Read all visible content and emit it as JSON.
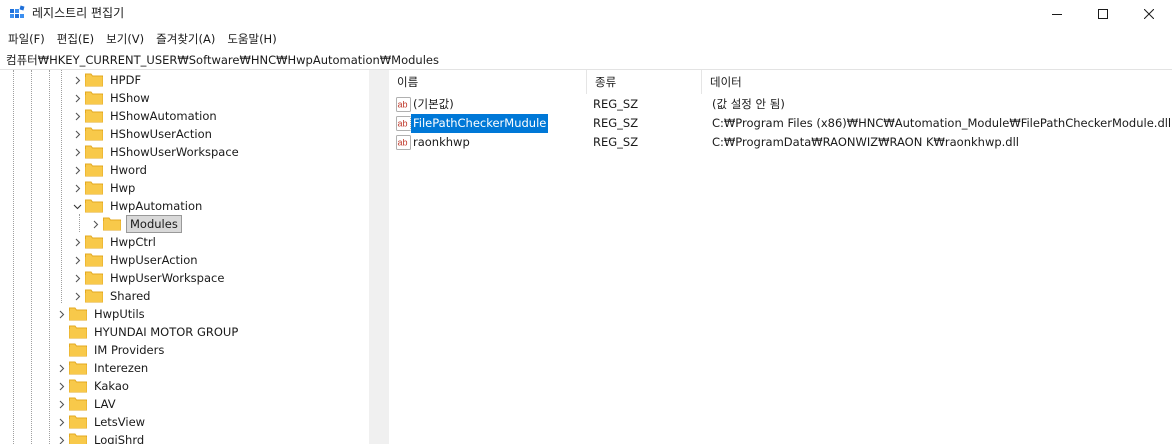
{
  "window": {
    "title": "레지스트리 편집기"
  },
  "menu": {
    "items": [
      "파일(F)",
      "편집(E)",
      "보기(V)",
      "즐겨찾기(A)",
      "도움말(H)"
    ]
  },
  "address": {
    "path": "컴퓨터₩HKEY_CURRENT_USER₩Software₩HNC₩HwpAutomation₩Modules"
  },
  "tree": {
    "items": [
      {
        "label": "HPDF",
        "selected": false
      },
      {
        "label": "HShow",
        "selected": false
      },
      {
        "label": "HShowAutomation",
        "selected": false
      },
      {
        "label": "HShowUserAction",
        "selected": false
      },
      {
        "label": "HShowUserWorkspace",
        "selected": false
      },
      {
        "label": "Hword",
        "selected": false
      },
      {
        "label": "Hwp",
        "selected": false
      },
      {
        "label": "HwpAutomation",
        "selected": false,
        "expanded": true
      },
      {
        "label": "Modules",
        "selected": true
      },
      {
        "label": "HwpCtrl",
        "selected": false
      },
      {
        "label": "HwpUserAction",
        "selected": false
      },
      {
        "label": "HwpUserWorkspace",
        "selected": false
      },
      {
        "label": "Shared",
        "selected": false
      },
      {
        "label": "HwpUtils",
        "selected": false
      },
      {
        "label": "HYUNDAI MOTOR GROUP",
        "selected": false
      },
      {
        "label": "IM Providers",
        "selected": false
      },
      {
        "label": "Interezen",
        "selected": false
      },
      {
        "label": "Kakao",
        "selected": false
      },
      {
        "label": "LAV",
        "selected": false
      },
      {
        "label": "LetsView",
        "selected": false
      },
      {
        "label": "LogiShrd",
        "selected": false
      }
    ]
  },
  "list": {
    "columns": [
      "이름",
      "종류",
      "데이터"
    ],
    "rows": [
      {
        "name": "(기본값)",
        "type": "REG_SZ",
        "data": "(값 설정 안 됨)",
        "selected": false
      },
      {
        "name": "FilePathCheckerMudule",
        "type": "REG_SZ",
        "data": "C:₩Program Files (x86)₩HNC₩Automation_Module₩FilePathCheckerModule.dll",
        "selected": true
      },
      {
        "name": "raonkhwp",
        "type": "REG_SZ",
        "data": "C:₩ProgramData₩RAONWIZ₩RAON K₩raonkhwp.dll",
        "selected": false
      }
    ]
  },
  "colors": {
    "selection": "#0078d7",
    "folder": "#f8c94a",
    "folder_dark": "#e3a920"
  }
}
